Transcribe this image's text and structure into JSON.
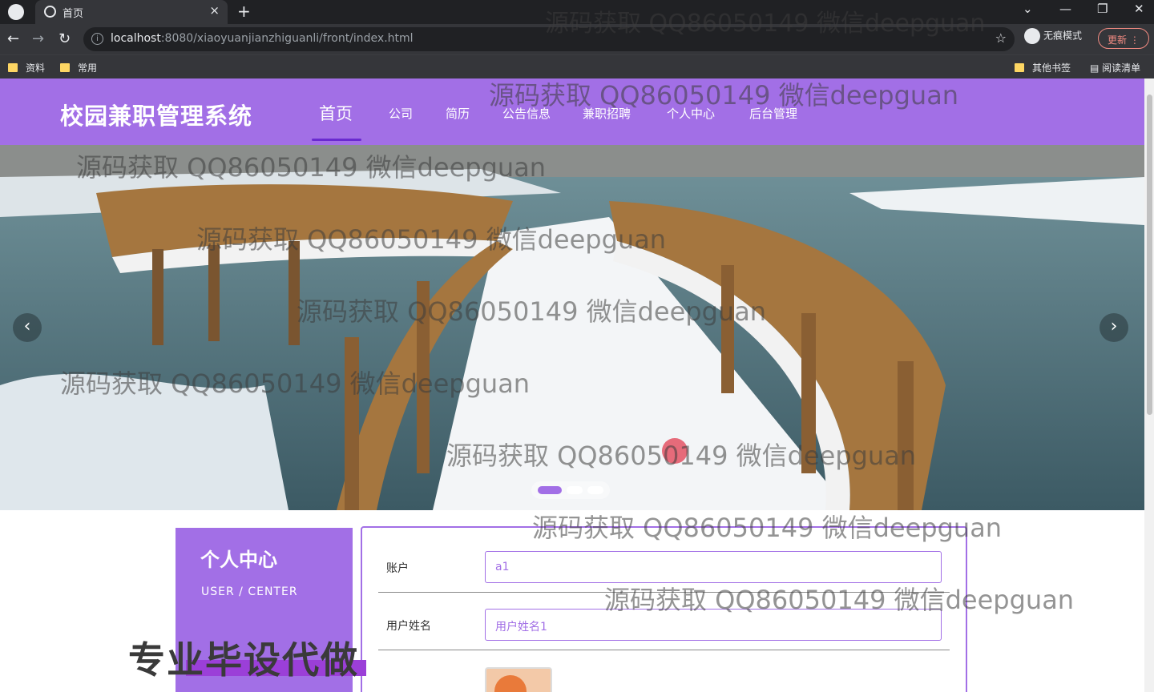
{
  "browser": {
    "tab_title": "首页",
    "url_host": "localhost",
    "url_rest": ":8080/xiaoyuanjianzhiguanli/front/index.html",
    "incognito_label": "无痕模式",
    "update_label": "更新",
    "bookmarks": [
      "资料",
      "常用"
    ],
    "other_bookmarks": "其他书签",
    "reading_list": "阅读清单"
  },
  "site": {
    "title": "校园兼职管理系统",
    "menu": [
      "首页",
      "公司",
      "简历",
      "公告信息",
      "兼职招聘",
      "个人中心",
      "后台管理"
    ]
  },
  "carousel": {
    "prev": "‹",
    "next": "›"
  },
  "user_center": {
    "title": "个人中心",
    "subtitle": "USER / CENTER"
  },
  "form": {
    "account_label": "账户",
    "account_value": "a1",
    "name_label": "用户姓名",
    "name_value": "用户姓名1"
  },
  "promo_text": "专业毕设代做",
  "watermark_text": "源码获取 QQ86050149 微信deepguan",
  "colors": {
    "accent": "#a26fe6",
    "chrome_dark": "#202124"
  }
}
